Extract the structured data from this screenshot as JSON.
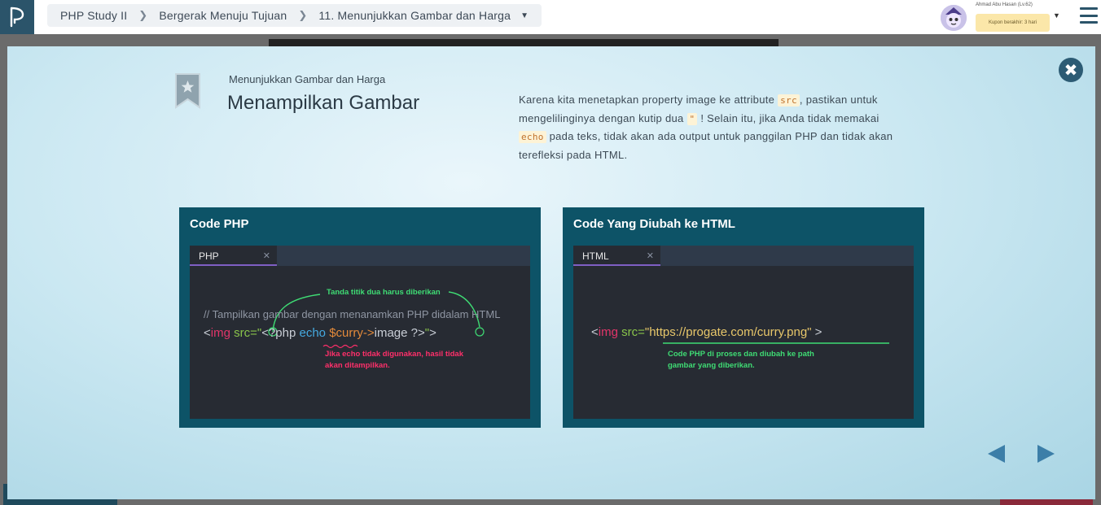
{
  "breadcrumb": {
    "items": [
      "PHP Study II",
      "Bergerak Menuju Tujuan",
      "11. Menunjukkan Gambar dan Harga"
    ]
  },
  "user": {
    "name": "Ahmad Abu Hasan (Lv.62)",
    "coupon": "Kupon berakhir: 3 hari"
  },
  "slide": {
    "subtitle": "Menunjukkan Gambar dan Harga",
    "title": "Menampilkan Gambar",
    "desc": {
      "p1": "Karena kita menetapkan property image ke attribute ",
      "code1": "src",
      "p2": ", pastikan untuk mengelilinginya dengan kutip dua ",
      "code2": "\"",
      "p3": " ! Selain itu, jika Anda tidak memakai ",
      "code3": "echo",
      "p4": " pada teks, tidak akan ada output untuk panggilan PHP dan tidak akan terefleksi pada HTML."
    },
    "left_panel": {
      "title": "Code PHP",
      "tab": "PHP",
      "comment": "// Tampilkan gambar dengan menanamkan PHP didalam HTML",
      "code": {
        "lt": "<",
        "tag": "img",
        "attr": " src=",
        "q1": "\"",
        "php_open": "<?php ",
        "echo": "echo",
        "var": " $curry->",
        "rest": "image ?>",
        "q2": "\"",
        "gt": ">"
      },
      "note_green": "Tanda titik dua harus diberikan",
      "note_red_1": "Jika echo tidak digunakan, hasil tidak",
      "note_red_2": "akan ditampilkan."
    },
    "right_panel": {
      "title": "Code Yang Diubah ke HTML",
      "tab": "HTML",
      "code": {
        "lt": "<",
        "tag": "img",
        "attr": " src=",
        "value": "\"https://progate.com/curry.png\"",
        "gt": " >"
      },
      "note_green_1": "Code PHP di proses dan diubah ke path",
      "note_green_2": "gambar yang diberikan."
    }
  },
  "icons": {
    "logo": "progate-logo-icon",
    "close": "close-icon",
    "prev": "prev-arrow-icon",
    "next": "next-arrow-icon",
    "menu": "hamburger-menu-icon"
  },
  "colors": {
    "brand": "#2b546a",
    "panel": "#0d5367",
    "tab_accent": "#7f5fc4"
  }
}
